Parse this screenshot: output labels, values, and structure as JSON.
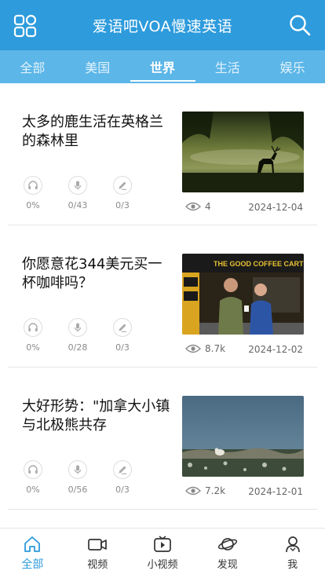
{
  "app": {
    "title": "爱语吧VOA慢速英语"
  },
  "tabs": [
    {
      "label": "全部"
    },
    {
      "label": "美国"
    },
    {
      "label": "世界",
      "active": true
    },
    {
      "label": "生活"
    },
    {
      "label": "娱乐"
    }
  ],
  "articles": [
    {
      "title": "太多的鹿生活在英格兰的森林里",
      "listen": "0%",
      "speak": "0/43",
      "write": "0/3",
      "views": "4",
      "date": "2024-12-04"
    },
    {
      "title": "你愿意花344美元买一杯咖啡吗？",
      "listen": "0%",
      "speak": "0/28",
      "write": "0/3",
      "views": "8.7k",
      "date": "2024-12-02",
      "sign_text": "THE GOOD COFFEE CARTEL"
    },
    {
      "title": "大好形势：\"加拿大小镇与北极熊共存",
      "listen": "0%",
      "speak": "0/56",
      "write": "0/3",
      "views": "7.2k",
      "date": "2024-12-01"
    }
  ],
  "bottom_nav": [
    {
      "label": "全部",
      "icon": "home-icon",
      "active": true
    },
    {
      "label": "视频",
      "icon": "video-camera-icon"
    },
    {
      "label": "小视频",
      "icon": "tv-play-icon"
    },
    {
      "label": "发现",
      "icon": "planet-icon"
    },
    {
      "label": "我",
      "icon": "user-icon"
    }
  ],
  "colors": {
    "primary": "#2d9bdc",
    "tab_bar": "#5cb6e8"
  }
}
